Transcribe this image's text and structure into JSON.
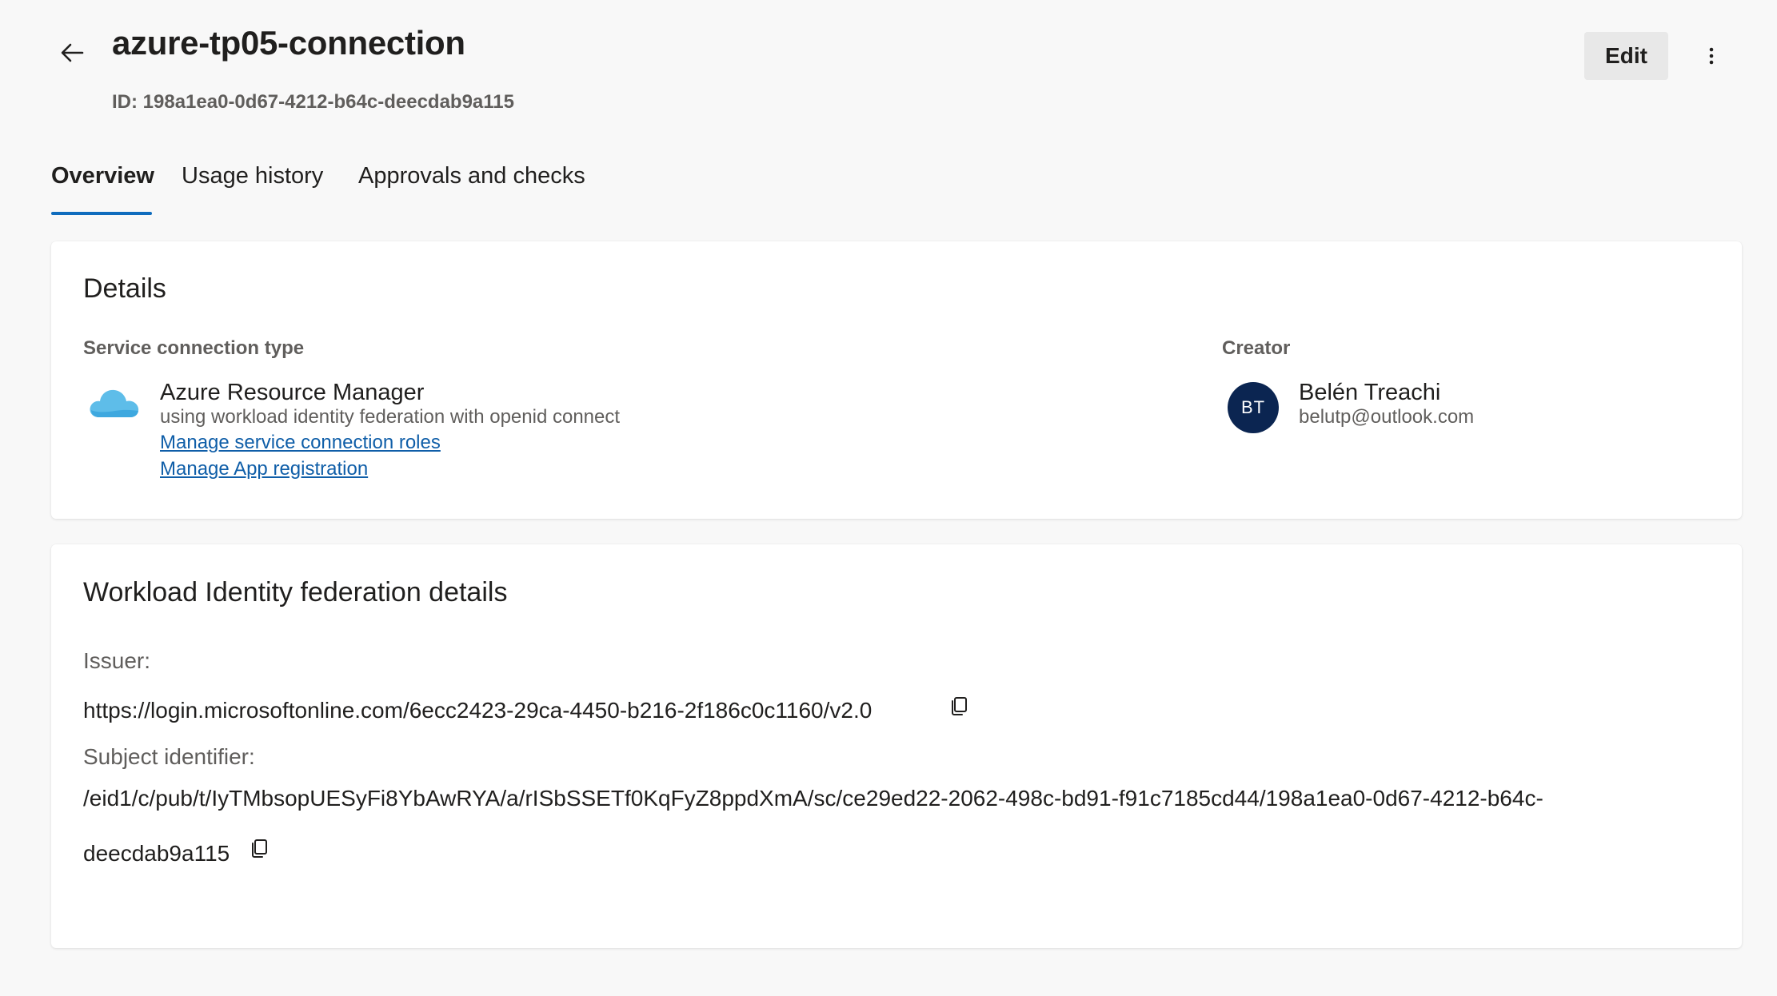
{
  "header": {
    "title": "azure-tp05-connection",
    "id_text": "ID: 198a1ea0-0d67-4212-b64c-deecdab9a115",
    "edit_label": "Edit"
  },
  "tabs": [
    {
      "label": "Overview",
      "active": true
    },
    {
      "label": "Usage history",
      "active": false
    },
    {
      "label": "Approvals and checks",
      "active": false
    }
  ],
  "details": {
    "heading": "Details",
    "type_label": "Service connection type",
    "type_name": "Azure Resource Manager",
    "type_description": "using workload identity federation with openid connect",
    "link_roles": "Manage service connection roles",
    "link_app": "Manage App registration",
    "creator_label": "Creator",
    "creator_initials": "BT",
    "creator_name": "Belén Treachi",
    "creator_email": "belutp@outlook.com"
  },
  "wif": {
    "heading": "Workload Identity federation details",
    "issuer_label": "Issuer:",
    "issuer_value": "https://login.microsoftonline.com/6ecc2423-29ca-4450-b216-2f186c0c1160/v2.0",
    "subject_label": "Subject identifier:",
    "subject_value_line1": "/eid1/c/pub/t/IyTMbsopUESyFi8YbAwRYA/a/rISbSSETf0KqFyZ8ppdXmA/sc/ce29ed22-2062-498c-bd91-f91c7185cd44/198a1ea0-0d67-4212-b64c-",
    "subject_value_line2": "deecdab9a115"
  },
  "colors": {
    "accent": "#0f6cbd",
    "link": "#0f5ea8",
    "avatar_bg": "#0b2551",
    "page_bg": "#f8f8f8"
  },
  "icons": {
    "back": "arrow-left-icon",
    "more": "more-vertical-icon",
    "service_type": "azure-cloud-icon",
    "copy": "copy-icon"
  }
}
